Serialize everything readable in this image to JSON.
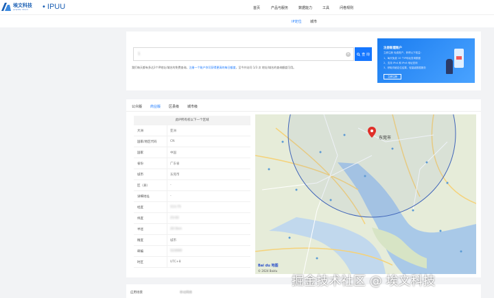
{
  "header": {
    "logo_cn": "埃文科技",
    "logo_en": "AIWEN TECH",
    "logo_brand": "• IPUU",
    "nav": [
      "首页",
      "产品与服务",
      "数据能力",
      "工具",
      "问卷规则"
    ]
  },
  "subnav": {
    "tabs": [
      "IP定位",
      "城市"
    ]
  },
  "search": {
    "value": "1",
    "button_label": "查 询",
    "intro_prefix": "我们每天都有多达3个IP地址/域名的免费查询。",
    "intro_link": "注册一个账户你可获得更高的每日额度",
    "intro_suffix": "，至今共访问 1/3 次 地址/域名的查询额度可用。"
  },
  "promo": {
    "title": "注册新建账户",
    "lines": [
      "立即注册 免费账户，获得以下权益：",
      "1、每天免费 10 个IP地址查询额度",
      "2、支持 IPv4 和 IPv6 地址查询",
      "3、获取详细定位结果，轻量级数据服务"
    ],
    "button_label": "立即注册"
  },
  "result": {
    "tabs": [
      "公众版",
      "商业版",
      "区县级",
      "城市级"
    ],
    "active_tab": 1,
    "table_header": "此IP所有权以下一个区域",
    "rows": [
      {
        "key": "大洲",
        "value": "亚洲",
        "blur": false
      },
      {
        "key": "国家/地区代码",
        "value": "CN",
        "blur": false
      },
      {
        "key": "国家",
        "value": "中国",
        "blur": false
      },
      {
        "key": "省份",
        "value": "广东省",
        "blur": false
      },
      {
        "key": "城市",
        "value": "东莞市",
        "blur": false
      },
      {
        "key": "区（县）",
        "value": "-",
        "blur": false
      },
      {
        "key": "详细地址",
        "value": "-",
        "blur": false
      },
      {
        "key": "经度",
        "value": "113.75",
        "blur": true
      },
      {
        "key": "纬度",
        "value": "23.02",
        "blur": true
      },
      {
        "key": "半径",
        "value": "20.5km",
        "blur": true
      },
      {
        "key": "精度",
        "value": "城市",
        "blur": false
      },
      {
        "key": "邮编",
        "value": "523000",
        "blur": true
      },
      {
        "key": "时区",
        "value": "UTC+8",
        "blur": false
      }
    ],
    "map": {
      "city_label": "东莞市",
      "copyright": "© 2024 Baidu",
      "logo": "Bai du 地图"
    }
  },
  "scenario": {
    "label": "应用场景",
    "value": "移动网络"
  },
  "watermark": "掘金技术社区 @ 埃文科技",
  "colors": {
    "accent": "#1677ff",
    "brand": "#1a5fb4"
  }
}
